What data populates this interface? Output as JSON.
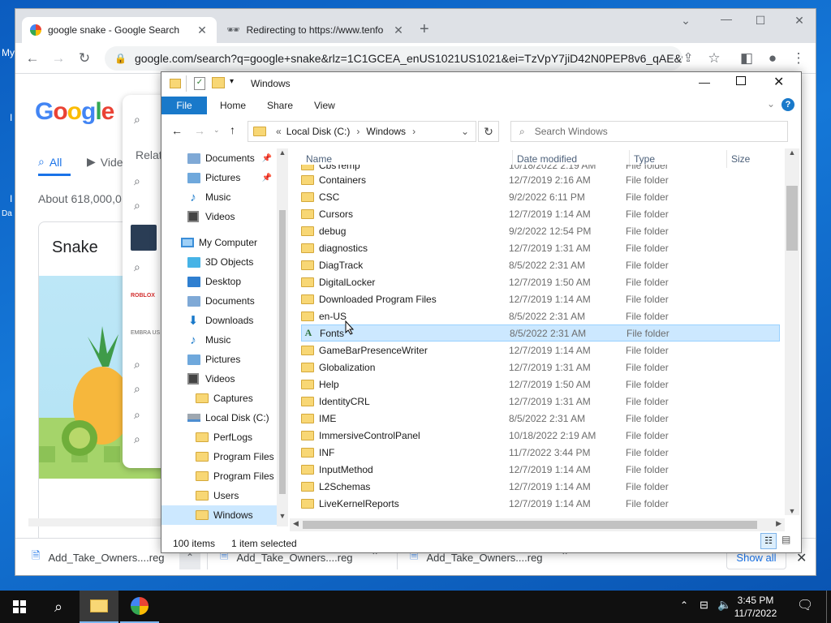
{
  "desktop": {
    "left_labels": [
      "My",
      "I",
      "Da"
    ]
  },
  "chrome": {
    "tabs": [
      {
        "label": "google snake - Google Search",
        "active": true
      },
      {
        "label": "Redirecting to https://www.tenfo",
        "active": false
      }
    ],
    "new_tab_glyph": "+",
    "url": "google.com/search?q=google+snake&rlz=1C1GCEA_enUS1021US1021&ei=TzVpY7jiD42N0PEP8v6_qAE&v...",
    "window_controls": [
      "⌄",
      "—",
      "☐",
      "✕"
    ]
  },
  "google": {
    "logo_letters": [
      "G",
      "o",
      "o",
      "g",
      "l",
      "e"
    ],
    "logo_colors": [
      "#4285f4",
      "#ea4335",
      "#fbbc05",
      "#4285f4",
      "#34a853",
      "#ea4335"
    ],
    "tabs": {
      "all": "All",
      "videos": "Vide"
    },
    "stats": "About 618,000,0",
    "card_title": "Snake",
    "suggest_related": "Relat",
    "suggest_tiny_labels": [
      "ROBLOX",
      "EMBRA US"
    ]
  },
  "downloads": {
    "items": [
      "Add_Take_Owners....reg",
      "Add_Take_Owners....reg",
      "Add_Take_Owners....reg"
    ],
    "show_all": "Show all",
    "close": "✕"
  },
  "explorer": {
    "title": "Windows",
    "ribbon_tabs": [
      "File",
      "Home",
      "Share",
      "View"
    ],
    "address": {
      "prefix": "«",
      "parts": [
        "Local Disk (C:)",
        "Windows"
      ],
      "sep": "›"
    },
    "search_placeholder": "Search Windows",
    "columns": {
      "name": "Name",
      "date": "Date modified",
      "type": "Type",
      "size": "Size"
    },
    "nav_quick": [
      {
        "label": "Documents",
        "icon": "documents",
        "pinned": true
      },
      {
        "label": "Pictures",
        "icon": "pictures",
        "pinned": true
      },
      {
        "label": "Music",
        "icon": "music",
        "pinned": false
      },
      {
        "label": "Videos",
        "icon": "videos",
        "pinned": false
      }
    ],
    "nav_pc": [
      {
        "label": "My Computer",
        "icon": "pc",
        "level": 0
      },
      {
        "label": "3D Objects",
        "icon": "blue",
        "level": 1
      },
      {
        "label": "Desktop",
        "icon": "blue",
        "level": 1
      },
      {
        "label": "Documents",
        "icon": "documents",
        "level": 1
      },
      {
        "label": "Downloads",
        "icon": "downloads",
        "level": 1
      },
      {
        "label": "Music",
        "icon": "music",
        "level": 1
      },
      {
        "label": "Pictures",
        "icon": "pictures",
        "level": 1
      },
      {
        "label": "Videos",
        "icon": "videos",
        "level": 1
      },
      {
        "label": "Captures",
        "icon": "folder",
        "level": 2
      },
      {
        "label": "Local Disk (C:)",
        "icon": "drive",
        "level": 1
      },
      {
        "label": "PerfLogs",
        "icon": "folder",
        "level": 2
      },
      {
        "label": "Program Files",
        "icon": "folder",
        "level": 2
      },
      {
        "label": "Program Files (",
        "icon": "folder",
        "level": 2
      },
      {
        "label": "Users",
        "icon": "folder",
        "level": 2
      },
      {
        "label": "Windows",
        "icon": "folder",
        "level": 2,
        "selected": true
      }
    ],
    "partial_row": {
      "name": "CbsTemp",
      "date": "10/18/2022 2:19 AM",
      "type": "File folder"
    },
    "files": [
      {
        "name": "Containers",
        "date": "12/7/2019 2:16 AM",
        "type": "File folder"
      },
      {
        "name": "CSC",
        "date": "9/2/2022 6:11 PM",
        "type": "File folder"
      },
      {
        "name": "Cursors",
        "date": "12/7/2019 1:14 AM",
        "type": "File folder"
      },
      {
        "name": "debug",
        "date": "9/2/2022 12:54 PM",
        "type": "File folder"
      },
      {
        "name": "diagnostics",
        "date": "12/7/2019 1:31 AM",
        "type": "File folder"
      },
      {
        "name": "DiagTrack",
        "date": "8/5/2022 2:31 AM",
        "type": "File folder"
      },
      {
        "name": "DigitalLocker",
        "date": "12/7/2019 1:50 AM",
        "type": "File folder"
      },
      {
        "name": "Downloaded Program Files",
        "date": "12/7/2019 1:14 AM",
        "type": "File folder"
      },
      {
        "name": "en-US",
        "date": "8/5/2022 2:31 AM",
        "type": "File folder"
      },
      {
        "name": "Fonts",
        "date": "8/5/2022 2:31 AM",
        "type": "File folder",
        "selected": true,
        "icon": "font"
      },
      {
        "name": "GameBarPresenceWriter",
        "date": "12/7/2019 1:14 AM",
        "type": "File folder"
      },
      {
        "name": "Globalization",
        "date": "12/7/2019 1:31 AM",
        "type": "File folder"
      },
      {
        "name": "Help",
        "date": "12/7/2019 1:50 AM",
        "type": "File folder"
      },
      {
        "name": "IdentityCRL",
        "date": "12/7/2019 1:31 AM",
        "type": "File folder"
      },
      {
        "name": "IME",
        "date": "8/5/2022 2:31 AM",
        "type": "File folder"
      },
      {
        "name": "ImmersiveControlPanel",
        "date": "10/18/2022 2:19 AM",
        "type": "File folder"
      },
      {
        "name": "INF",
        "date": "11/7/2022 3:44 PM",
        "type": "File folder"
      },
      {
        "name": "InputMethod",
        "date": "12/7/2019 1:14 AM",
        "type": "File folder"
      },
      {
        "name": "L2Schemas",
        "date": "12/7/2019 1:14 AM",
        "type": "File folder"
      },
      {
        "name": "LiveKernelReports",
        "date": "12/7/2019 1:14 AM",
        "type": "File folder"
      }
    ],
    "status": {
      "items": "100 items",
      "selected": "1 item selected"
    }
  },
  "taskbar": {
    "time": "3:45 PM",
    "date": "11/7/2022"
  }
}
